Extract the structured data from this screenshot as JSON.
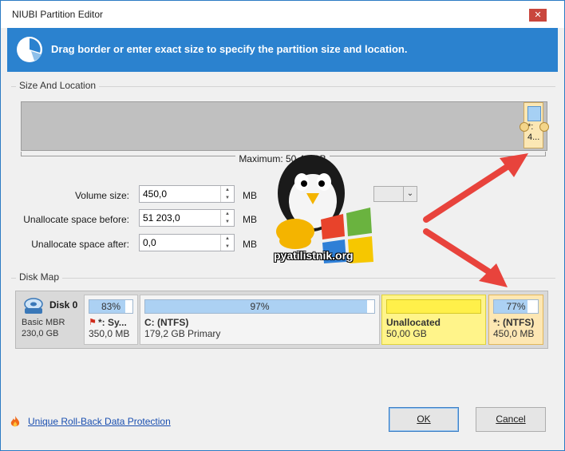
{
  "window": {
    "title": "NIUBI Partition Editor",
    "close_glyph": "✕"
  },
  "banner": {
    "icon": "pie-chart-icon",
    "text": "Drag border or enter exact size to specify the partition size and location."
  },
  "size_location": {
    "group_label": "Size And Location",
    "partition_label": "*: 4...",
    "maximum_label": "Maximum: 50,44 GB",
    "fields": [
      {
        "label": "Volume size:",
        "value": "450,0",
        "unit": "MB"
      },
      {
        "label": "Unallocate space before:",
        "value": "51 203,0",
        "unit": "MB"
      },
      {
        "label": "Unallocate space after:",
        "value": "0,0",
        "unit": "MB"
      }
    ],
    "dropdown_value": ""
  },
  "watermark": {
    "text": "pyatilistnik.org"
  },
  "disk_map": {
    "group_label": "Disk Map",
    "disk": {
      "name": "Disk 0",
      "type": "Basic MBR",
      "size": "230,0 GB",
      "icon": "hard-disk-icon"
    },
    "partitions": [
      {
        "percent": "83%",
        "fill": 0.83,
        "name": "*: Sy...",
        "info": "350,0 MB",
        "icon": "system-flag-icon"
      },
      {
        "percent": "97%",
        "fill": 0.97,
        "name": "C: (NTFS)",
        "info": "179,2 GB Primary"
      },
      {
        "percent": "",
        "fill": 1.0,
        "name": "Unallocated",
        "info": "50,00 GB"
      },
      {
        "percent": "77%",
        "fill": 0.77,
        "name": "*: (NTFS)",
        "info": "450,0 MB"
      }
    ]
  },
  "footer": {
    "link_text": "Unique Roll-Back Data Protection",
    "link_icon": "flame-icon"
  },
  "buttons": {
    "ok": "OK",
    "cancel": "Cancel"
  },
  "colors": {
    "banner": "#2b82cf",
    "unallocated": "#fff48a",
    "selected_partition": "#fde7b3",
    "annotation_arrow": "#e8433c"
  }
}
